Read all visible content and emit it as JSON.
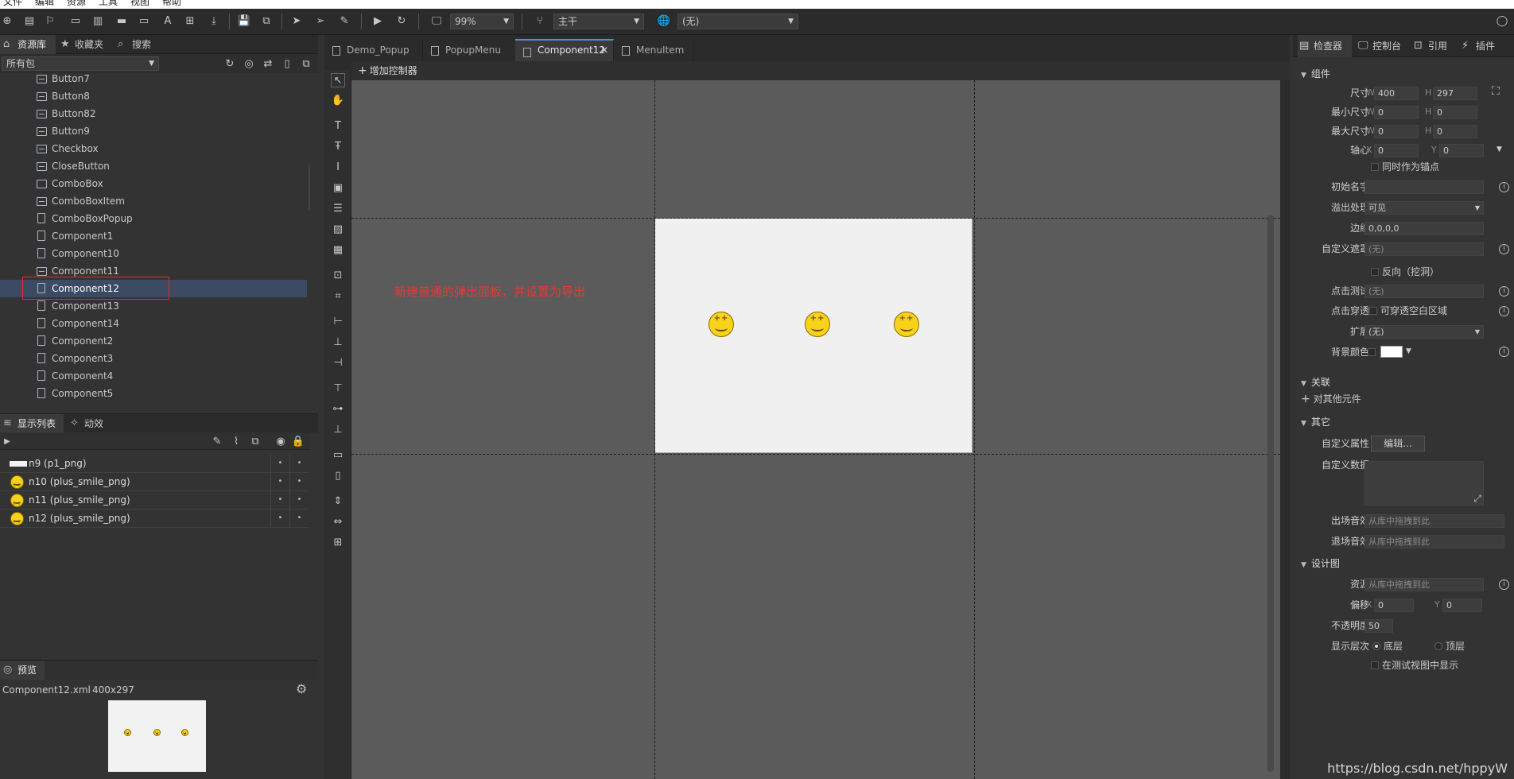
{
  "menubar": {
    "items": [
      "文件",
      "编辑",
      "资源",
      "工具",
      "视图",
      "帮助"
    ]
  },
  "toolbar": {
    "zoom": "99%",
    "branch": "主干",
    "language": "(无)"
  },
  "left_tabs": {
    "library": "资源库",
    "favorites": "收藏夹",
    "search": "搜索"
  },
  "package_select": "所有包",
  "resources": [
    {
      "name": "Button7",
      "icon": "button-icon"
    },
    {
      "name": "Button8",
      "icon": "button-icon"
    },
    {
      "name": "Button82",
      "icon": "button-icon"
    },
    {
      "name": "Button9",
      "icon": "button-icon"
    },
    {
      "name": "Checkbox",
      "icon": "button-icon"
    },
    {
      "name": "CloseButton",
      "icon": "button-icon"
    },
    {
      "name": "ComboBox",
      "icon": "combobox-icon"
    },
    {
      "name": "ComboBoxItem",
      "icon": "button-icon"
    },
    {
      "name": "ComboBoxPopup",
      "icon": "component-icon"
    },
    {
      "name": "Component1",
      "icon": "component-icon"
    },
    {
      "name": "Component10",
      "icon": "component-icon"
    },
    {
      "name": "Component11",
      "icon": "component-icon"
    },
    {
      "name": "Component12",
      "icon": "component-icon"
    },
    {
      "name": "Component13",
      "icon": "component-icon"
    },
    {
      "name": "Component14",
      "icon": "component-icon"
    },
    {
      "name": "Component2",
      "icon": "component-icon"
    },
    {
      "name": "Component3",
      "icon": "bookmark-icon"
    },
    {
      "name": "Component4",
      "icon": "component-icon"
    },
    {
      "name": "Component5",
      "icon": "component-icon"
    }
  ],
  "display_tabs": {
    "list": "显示列表",
    "effects": "动效"
  },
  "display_list": [
    {
      "name": "n9 (p1_png)",
      "thumb": "rect"
    },
    {
      "name": "n10 (plus_smile_png)",
      "thumb": "smile"
    },
    {
      "name": "n11 (plus_smile_png)",
      "thumb": "smile"
    },
    {
      "name": "n12 (plus_smile_png)",
      "thumb": "smile"
    }
  ],
  "preview": {
    "tab": "预览",
    "file": "Component12.xml",
    "size": "400x297"
  },
  "doc_tabs": [
    "Demo_Popup",
    "PopupMenu",
    "Component12",
    "MenuItem"
  ],
  "active_doc_tab": "Component12",
  "add_controller": "增加控制器",
  "stage_annotation": "新建普通的弹出面板，并设置为导出",
  "right_tabs": {
    "inspector": "检查器",
    "console": "控制台",
    "references": "引用",
    "plugins": "插件"
  },
  "inspector": {
    "section_component": "组件",
    "size_label": "尺寸",
    "size_w": "400",
    "size_h": "297",
    "min_label": "最小尺寸",
    "min_w": "0",
    "min_h": "0",
    "max_label": "最大尺寸",
    "max_w": "0",
    "max_h": "0",
    "pivot_label": "轴心",
    "pivot_x": "0",
    "pivot_y": "0",
    "pivot_anchor": "同时作为锚点",
    "init_name_label": "初始名字",
    "init_name": "",
    "overflow_label": "溢出处理",
    "overflow": "可见",
    "margin_label": "边缘",
    "margin": "0,0,0,0",
    "mask_label": "自定义遮罩",
    "mask": "(无)",
    "mask_reverse": "反向（挖洞）",
    "hittest_label": "点击测试",
    "hittest": "(无)",
    "clickthrough_label": "点击穿透",
    "clickthrough": "可穿透空白区域",
    "extend_label": "扩展",
    "extend": "(无)",
    "bgcolor_label": "背景颜色",
    "bgcolor": "#ffffff",
    "section_relation": "关联",
    "relation_add": "对其他元件",
    "section_other": "其它",
    "custom_prop_label": "自定义属性",
    "custom_prop_btn": "编辑...",
    "custom_data_label": "自定义数据",
    "enter_sound_label": "出场音效",
    "enter_sound": "从库中拖拽到此",
    "exit_sound_label": "退场音效",
    "exit_sound": "从库中拖拽到此",
    "section_design": "设计图",
    "res_label": "资源",
    "res": "从库中拖拽到此",
    "offset_label": "偏移",
    "offset_x": "0",
    "offset_y": "0",
    "opacity_label": "不透明度",
    "opacity": "50",
    "layer_label": "显示层次",
    "layer_bottom": "底层",
    "layer_top": "顶层",
    "show_in_test": "在测试视图中显示",
    "axis_w": "W",
    "axis_h": "H",
    "axis_x": "X",
    "axis_y": "Y"
  },
  "watermark": "https://blog.csdn.net/hppyW",
  "colors": {
    "accent": "#4a90e2",
    "selection": "#3c4a63",
    "annotation": "#e53935",
    "stage": "#5b5b5b"
  }
}
